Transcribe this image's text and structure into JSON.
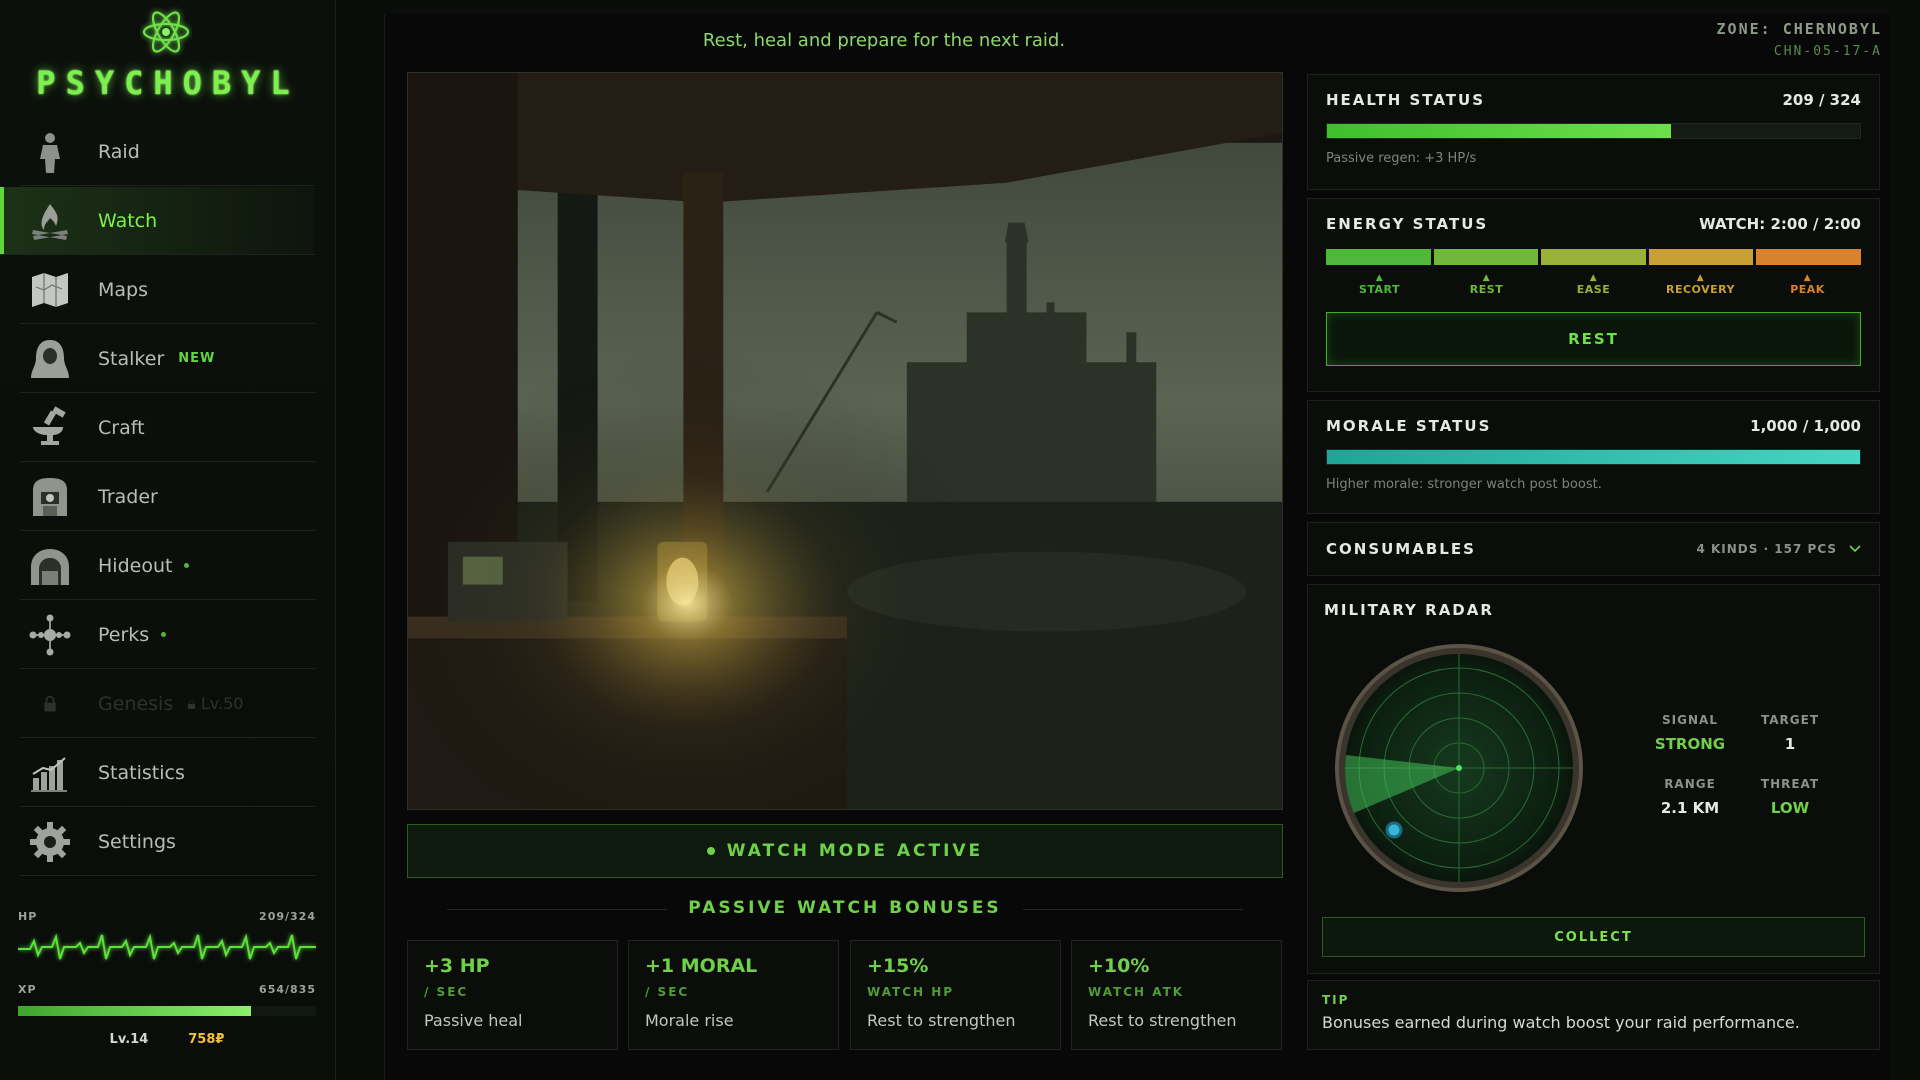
{
  "app": {
    "logo_text": "PSYCHOBYL",
    "logo_icon": "atom-icon",
    "accent_color": "#7ef04e"
  },
  "sidebar": {
    "items": [
      {
        "label": "Raid",
        "icon": "stalker-figure-icon"
      },
      {
        "label": "Watch",
        "icon": "campfire-icon",
        "active": true
      },
      {
        "label": "Maps",
        "icon": "map-icon"
      },
      {
        "label": "Stalker",
        "icon": "hooded-stalker-icon",
        "badge": "NEW"
      },
      {
        "label": "Craft",
        "icon": "anvil-icon"
      },
      {
        "label": "Trader",
        "icon": "trader-icon"
      },
      {
        "label": "Hideout",
        "icon": "bunker-icon",
        "dot": true
      },
      {
        "label": "Perks",
        "icon": "perks-network-icon",
        "dot": true
      },
      {
        "label": "Genesis",
        "icon": "lock-icon",
        "locked": true,
        "lock_text": "Lv.50"
      },
      {
        "label": "Statistics",
        "icon": "bar-chart-icon"
      },
      {
        "label": "Settings",
        "icon": "gear-icon"
      }
    ],
    "vitals": {
      "hp_label": "HP",
      "hp_value": "209/324",
      "xp_label": "XP",
      "xp_value": "654/835",
      "xp_fraction": 0.783,
      "level": "Lv.14",
      "currency": "758₽"
    }
  },
  "header": {
    "subtitle": "Rest, heal and prepare for the next raid.",
    "zone_label": "ZONE:",
    "zone_name": "CHERNOBYL",
    "zone_code": "CHN-05-17-A"
  },
  "scene": {
    "alt": "Chernobyl watch post at night with lantern and radio"
  },
  "watch_mode": {
    "label": "WATCH MODE ACTIVE"
  },
  "bonuses": {
    "title": "PASSIVE WATCH BONUSES",
    "cards": [
      {
        "value": "+3 HP",
        "sub": "/ SEC",
        "desc": "Passive heal"
      },
      {
        "value": "+1 MORAL",
        "sub": "/ SEC",
        "desc": "Morale rise"
      },
      {
        "value": "+15%",
        "sub": "WATCH HP",
        "desc": "Rest to strengthen"
      },
      {
        "value": "+10%",
        "sub": "WATCH ATK",
        "desc": "Rest to strengthen"
      }
    ]
  },
  "health": {
    "title": "HEALTH STATUS",
    "value": "209 / 324",
    "fraction": 0.645,
    "hint": "Passive regen: +3 HP/s"
  },
  "energy": {
    "title": "ENERGY STATUS",
    "value": "WATCH: 2:00 / 2:00",
    "segments": [
      {
        "label": "START",
        "color": "#4fb83c"
      },
      {
        "label": "REST",
        "color": "#6fb83a"
      },
      {
        "label": "EASE",
        "color": "#9bb038"
      },
      {
        "label": "RECOVERY",
        "color": "#c9a035"
      },
      {
        "label": "PEAK",
        "color": "#d9812c"
      }
    ],
    "button": "REST"
  },
  "morale": {
    "title": "MORALE STATUS",
    "value": "1,000 / 1,000",
    "fraction": 1.0,
    "hint": "Higher morale: stronger watch post boost."
  },
  "consumables": {
    "title": "CONSUMABLES",
    "meta": "4 KINDS · 157 PCS"
  },
  "radar": {
    "title": "MILITARY RADAR",
    "stats": [
      {
        "label": "SIGNAL",
        "value": "STRONG",
        "green": true
      },
      {
        "label": "TARGET",
        "value": "1",
        "green": false
      },
      {
        "label": "RANGE",
        "value": "2.1 KM",
        "green": false
      },
      {
        "label": "THREAT",
        "value": "LOW",
        "green": true
      }
    ],
    "button": "COLLECT"
  },
  "tip": {
    "label": "TIP",
    "text": "Bonuses earned during watch boost your raid performance."
  }
}
